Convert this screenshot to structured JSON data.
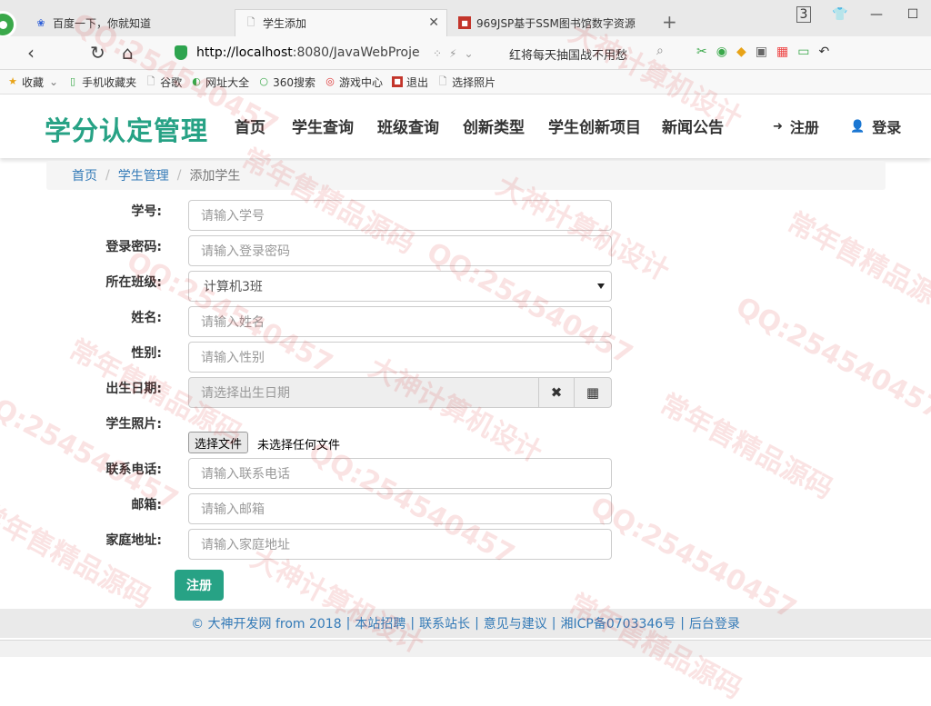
{
  "browser": {
    "tabs": [
      {
        "label": "百度一下，你就知道",
        "active": false
      },
      {
        "label": "学生添加",
        "active": true
      },
      {
        "label": "969JSP基于SSM图书馆数字资源",
        "active": false
      }
    ],
    "tab_count": "3",
    "url_host": "http://localhost",
    "url_rest": ":8080/JavaWebProje",
    "search_text": "红将每天抽国战不用愁",
    "bookmarks": [
      "收藏",
      "手机收藏夹",
      "谷歌",
      "网址大全",
      "360搜索",
      "游戏中心",
      "退出",
      "选择照片"
    ]
  },
  "site": {
    "brand": "学分认定管理",
    "nav": [
      "首页",
      "学生查询",
      "班级查询",
      "创新类型",
      "学生创新项目",
      "新闻公告"
    ],
    "register": "注册",
    "login": "登录"
  },
  "breadcrumb": {
    "home": "首页",
    "section": "学生管理",
    "current": "添加学生",
    "sep": "/"
  },
  "form": {
    "student_no": {
      "label": "学号:",
      "placeholder": "请输入学号"
    },
    "password": {
      "label": "登录密码:",
      "placeholder": "请输入登录密码"
    },
    "class": {
      "label": "所在班级:",
      "value": "计算机3班"
    },
    "name": {
      "label": "姓名:",
      "placeholder": "请输入姓名"
    },
    "gender": {
      "label": "性别:",
      "placeholder": "请输入性别"
    },
    "birthday": {
      "label": "出生日期:",
      "placeholder": "请选择出生日期"
    },
    "photo": {
      "label": "学生照片:",
      "button": "选择文件",
      "status": "未选择任何文件"
    },
    "phone": {
      "label": "联系电话:",
      "placeholder": "请输入联系电话"
    },
    "email": {
      "label": "邮箱:",
      "placeholder": "请输入邮箱"
    },
    "address": {
      "label": "家庭地址:",
      "placeholder": "请输入家庭地址"
    },
    "submit": "注册"
  },
  "footer": {
    "copyright": "© 大神开发网 from 2018",
    "links": [
      "本站招聘",
      "联系站长",
      "意见与建议",
      "湘ICP备0703346号",
      "后台登录"
    ]
  },
  "watermarks": [
    "大神计算机设计",
    "常年售精品源码",
    "QQ:254540457"
  ],
  "colors": {
    "brand": "#27a285",
    "link": "#337ab7"
  }
}
